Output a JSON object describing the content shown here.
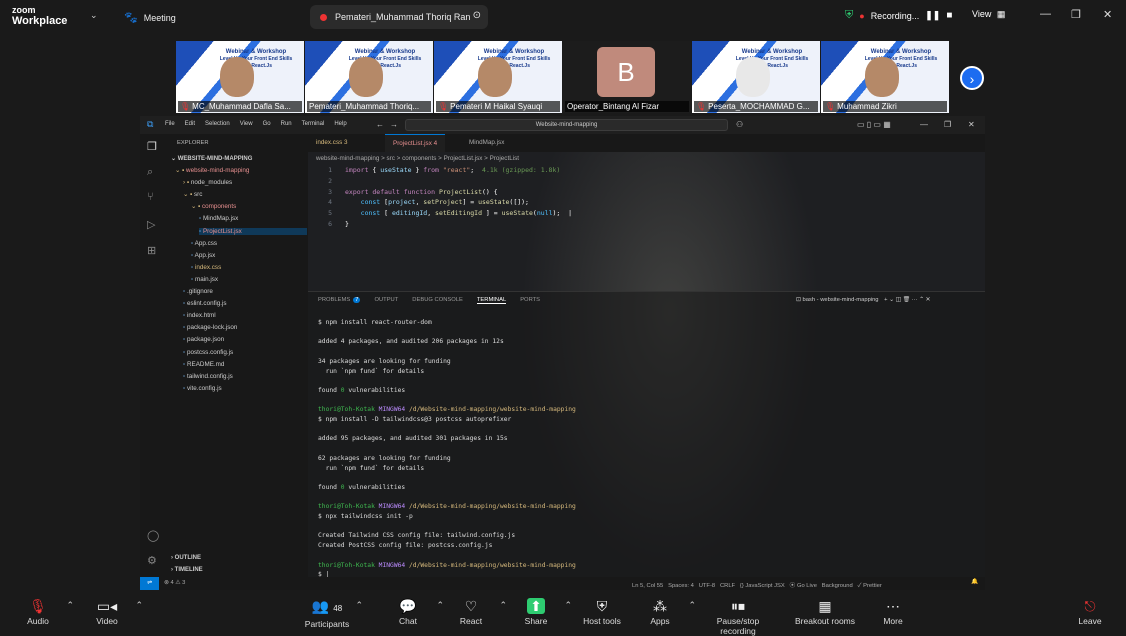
{
  "app": {
    "brand_top": "zoom",
    "brand_bottom": "Workplace",
    "meeting": "Meeting",
    "share_title": "Pemateri_Muhammad Thoriq Ran",
    "recording": "Recording...",
    "view": "View"
  },
  "participants": [
    {
      "name": "MC_Muhammad Dafla Sa...",
      "muted": true
    },
    {
      "name": "Pemateri_Muhammad Thoriq...",
      "muted": false
    },
    {
      "name": "Pemateri M Haikal Syauqi",
      "muted": true
    },
    {
      "name": "Operator_Bintang Al Fizar",
      "muted": false,
      "initial": "B"
    },
    {
      "name": "Peserta_MOCHAMMAD G...",
      "muted": true
    },
    {
      "name": "Muhammad Zikri",
      "muted": true
    }
  ],
  "webinar_title": "Webinar & Workshop",
  "webinar_sub": "Level Up Your Front End Skills with React.Js",
  "vscode": {
    "menu": [
      "File",
      "Edit",
      "Selection",
      "View",
      "Go",
      "Run",
      "Terminal",
      "Help"
    ],
    "search": "Website-mind-mapping",
    "explorer": "EXPLORER",
    "root": "WEBSITE-MIND-MAPPING",
    "tree": [
      {
        "name": "website-mind-mapping",
        "depth": 0,
        "color": "#e89090"
      },
      {
        "name": "node_modules",
        "depth": 1,
        "color": "#ccc"
      },
      {
        "name": "src",
        "depth": 1,
        "color": "#ccc"
      },
      {
        "name": "components",
        "depth": 2,
        "color": "#e89090"
      },
      {
        "name": "MindMap.jsx",
        "depth": 3,
        "color": "#ccc"
      },
      {
        "name": "ProjectList.jsx",
        "depth": 3,
        "color": "#e89090"
      },
      {
        "name": "App.css",
        "depth": 2,
        "color": "#ccc"
      },
      {
        "name": "App.jsx",
        "depth": 2,
        "color": "#ccc"
      },
      {
        "name": "index.css",
        "depth": 2,
        "color": "#d7ba7d"
      },
      {
        "name": "main.jsx",
        "depth": 2,
        "color": "#ccc"
      },
      {
        "name": ".gitignore",
        "depth": 1,
        "color": "#ccc"
      },
      {
        "name": "eslint.config.js",
        "depth": 1,
        "color": "#ccc"
      },
      {
        "name": "index.html",
        "depth": 1,
        "color": "#ccc"
      },
      {
        "name": "package-lock.json",
        "depth": 1,
        "color": "#ccc"
      },
      {
        "name": "package.json",
        "depth": 1,
        "color": "#ccc"
      },
      {
        "name": "postcss.config.js",
        "depth": 1,
        "color": "#ccc"
      },
      {
        "name": "README.md",
        "depth": 1,
        "color": "#ccc"
      },
      {
        "name": "tailwind.config.js",
        "depth": 1,
        "color": "#ccc"
      },
      {
        "name": "vite.config.js",
        "depth": 1,
        "color": "#ccc"
      }
    ],
    "outline": "OUTLINE",
    "timeline": "TIMELINE",
    "tabs": [
      "index.css 3",
      "ProjectList.jsx 4",
      "MindMap.jsx"
    ],
    "breadcrumb": "website-mind-mapping > src > components > ProjectList.jsx > ProjectList",
    "code_lines": [
      "import { useState } from \"react\";  4.1k (gzipped: 1.8k)",
      "",
      "export default function ProjectList() {",
      "    const [project, setProject] = useState([]);",
      "    const [ editingId, setEditingId ] = useState(null);",
      "}"
    ],
    "panel_tabs": [
      "PROBLEMS",
      "OUTPUT",
      "DEBUG CONSOLE",
      "TERMINAL",
      "PORTS"
    ],
    "problems_count": "7",
    "terminal_title": "bash - website-mind-mapping",
    "terminal_lines": [
      "$ npm install react-router-dom",
      "",
      "added 4 packages, and audited 206 packages in 12s",
      "",
      "34 packages are looking for funding",
      "  run `npm fund` for details",
      "",
      "found 0 vulnerabilities",
      "",
      "thori@Toh-Kotak MINGW64 /d/Website-mind-mapping/website-mind-mapping",
      "$ npm install -D tailwindcss@3 postcss autoprefixer",
      "",
      "added 95 packages, and audited 301 packages in 15s",
      "",
      "62 packages are looking for funding",
      "  run `npm fund` for details",
      "",
      "found 0 vulnerabilities",
      "",
      "thori@Toh-Kotak MINGW64 /d/Website-mind-mapping/website-mind-mapping",
      "$ npx tailwindcss init -p",
      "",
      "Created Tailwind CSS config file: tailwind.config.js",
      "Created PostCSS config file: postcss.config.js",
      "",
      "thori@Toh-Kotak MINGW64 /d/Website-mind-mapping/website-mind-mapping",
      "$ |"
    ],
    "status_left": "⊗ 4 ⚠ 3",
    "status_right": "Ln 5, Col 55   Spaces: 4   UTF-8   CRLF   {} JavaScript JSX   ⦿ Go Live   Background   ✓ Prettier"
  },
  "toolbar": [
    {
      "label": "Audio",
      "icon": "mic-muted-icon"
    },
    {
      "label": "Video",
      "icon": "video-icon"
    },
    {
      "label": "Participants",
      "icon": "participants-icon",
      "count": "48"
    },
    {
      "label": "Chat",
      "icon": "chat-icon"
    },
    {
      "label": "React",
      "icon": "heart-icon"
    },
    {
      "label": "Share",
      "icon": "share-icon"
    },
    {
      "label": "Host tools",
      "icon": "shield-icon"
    },
    {
      "label": "Apps",
      "icon": "apps-icon"
    },
    {
      "label": "Pause/stop recording",
      "icon": "record-icon"
    },
    {
      "label": "Breakout rooms",
      "icon": "breakout-icon"
    },
    {
      "label": "More",
      "icon": "more-icon"
    },
    {
      "label": "Leave",
      "icon": "leave-icon"
    }
  ]
}
